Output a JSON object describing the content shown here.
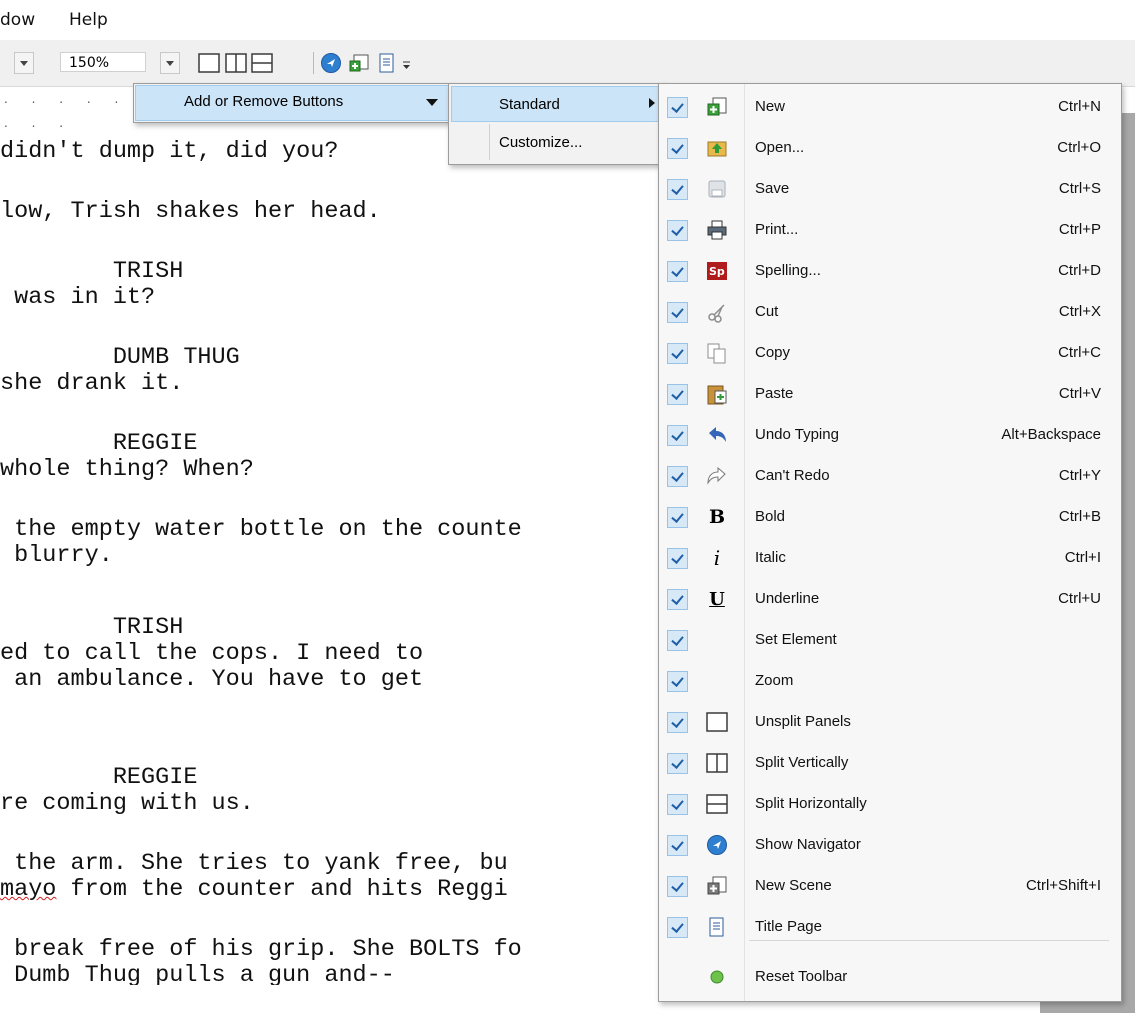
{
  "menubar": {
    "items": [
      "dow",
      "Help"
    ]
  },
  "toolbar": {
    "zoom": "150%"
  },
  "ruler": {
    "marks": ". . . . . . . ."
  },
  "script_lines": [
    "didn't dump it, did you?",
    "low, Trish shakes her head.",
    "        TRISH",
    " was in it?",
    "        DUMB THUG",
    "she drank it.",
    "        REGGIE",
    "whole thing? When?",
    " the empty water bottle on the counte",
    " blurry.",
    "        TRISH",
    "ed to call the cops. I need to",
    " an ambulance. You have to get",
    "        REGGIE",
    "re coming with us.",
    " the arm. She tries to yank free, bu",
    "mayo",
    " from the counter and hits Reggi",
    " break free of his grip. She BOLTS fo",
    " Dumb Thug pulls a gun and--"
  ],
  "menu1": {
    "label": "Add or Remove Buttons"
  },
  "menu2": {
    "items": [
      "Standard",
      "Customize..."
    ]
  },
  "menu3": {
    "items": [
      {
        "label": "New",
        "shortcut": "Ctrl+N",
        "icon": "new-icon"
      },
      {
        "label": "Open...",
        "shortcut": "Ctrl+O",
        "icon": "open-icon"
      },
      {
        "label": "Save",
        "shortcut": "Ctrl+S",
        "icon": "save-icon"
      },
      {
        "label": "Print...",
        "shortcut": "Ctrl+P",
        "icon": "print-icon"
      },
      {
        "label": "Spelling...",
        "shortcut": "Ctrl+D",
        "icon": "spelling-icon"
      },
      {
        "label": "Cut",
        "shortcut": "Ctrl+X",
        "icon": "cut-icon"
      },
      {
        "label": "Copy",
        "shortcut": "Ctrl+C",
        "icon": "copy-icon"
      },
      {
        "label": "Paste",
        "shortcut": "Ctrl+V",
        "icon": "paste-icon"
      },
      {
        "label": "Undo Typing",
        "shortcut": "Alt+Backspace",
        "icon": "undo-icon"
      },
      {
        "label": "Can't Redo",
        "shortcut": "Ctrl+Y",
        "icon": "redo-icon"
      },
      {
        "label": "Bold",
        "shortcut": "Ctrl+B",
        "icon": "bold-icon"
      },
      {
        "label": "Italic",
        "shortcut": "Ctrl+I",
        "icon": "italic-icon"
      },
      {
        "label": "Underline",
        "shortcut": "Ctrl+U",
        "icon": "underline-icon"
      },
      {
        "label": "Set Element",
        "shortcut": "",
        "icon": ""
      },
      {
        "label": "Zoom",
        "shortcut": "",
        "icon": ""
      },
      {
        "label": "Unsplit Panels",
        "shortcut": "",
        "icon": "unsplit-icon"
      },
      {
        "label": "Split Vertically",
        "shortcut": "",
        "icon": "split-vertical-icon"
      },
      {
        "label": "Split Horizontally",
        "shortcut": "",
        "icon": "split-horizontal-icon"
      },
      {
        "label": "Show Navigator",
        "shortcut": "",
        "icon": "navigator-icon"
      },
      {
        "label": "New Scene",
        "shortcut": "Ctrl+Shift+I",
        "icon": "new-scene-icon"
      },
      {
        "label": "Title Page",
        "shortcut": "",
        "icon": "title-page-icon"
      }
    ],
    "reset_label": "Reset Toolbar"
  },
  "colors": {
    "menu_highlight": "#cce4f7",
    "check_fill": "#d7e8f7",
    "spell_red": "#b01c1c"
  }
}
